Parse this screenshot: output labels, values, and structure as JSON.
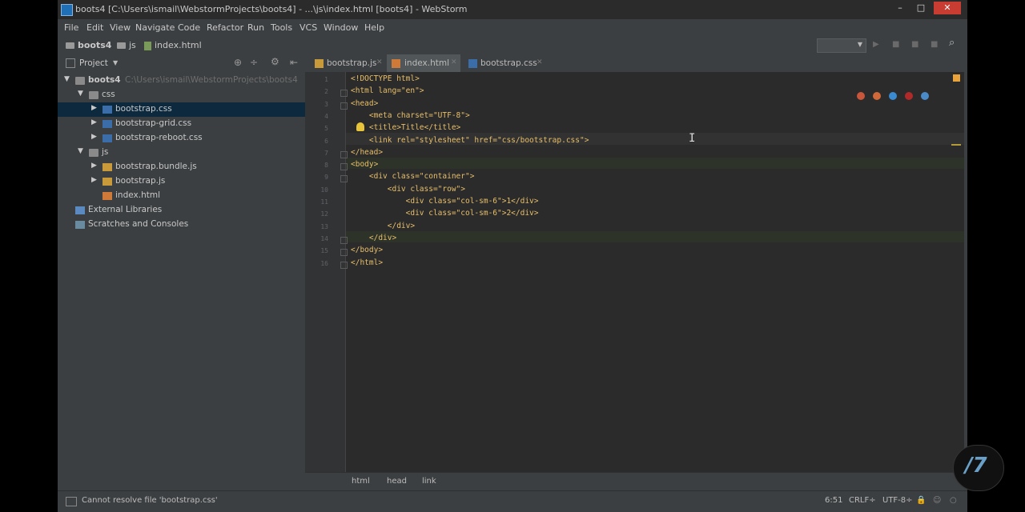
{
  "window": {
    "title": "boots4 [C:\\Users\\ismail\\WebstormProjects\\boots4] - ...\\js\\index.html [boots4] - WebStorm",
    "minimize": "–",
    "maximize": "□",
    "close": "✕"
  },
  "menu": [
    "File",
    "Edit",
    "View",
    "Navigate",
    "Code",
    "Refactor",
    "Run",
    "Tools",
    "VCS",
    "Window",
    "Help"
  ],
  "navbar": {
    "crumbs": [
      {
        "label": "boots4",
        "icon": "folder-icon"
      },
      {
        "label": "js",
        "icon": "folder-icon"
      },
      {
        "label": "index.html",
        "icon": "html-file-icon"
      }
    ]
  },
  "project_panel": {
    "title": "Project",
    "tree": [
      {
        "label": "boots4",
        "path": "C:\\Users\\ismail\\WebstormProjects\\boots4",
        "icon": "folder",
        "arrow": "▼",
        "depth": 0
      },
      {
        "label": "css",
        "path": "",
        "icon": "folder",
        "arrow": "▼",
        "depth": 1
      },
      {
        "label": "bootstrap.css",
        "path": "",
        "icon": "css",
        "arrow": "▶",
        "depth": 2,
        "selected": true
      },
      {
        "label": "bootstrap-grid.css",
        "path": "",
        "icon": "css",
        "arrow": "▶",
        "depth": 2
      },
      {
        "label": "bootstrap-reboot.css",
        "path": "",
        "icon": "css",
        "arrow": "▶",
        "depth": 2
      },
      {
        "label": "js",
        "path": "",
        "icon": "folder",
        "arrow": "▼",
        "depth": 1
      },
      {
        "label": "bootstrap.bundle.js",
        "path": "",
        "icon": "js",
        "arrow": "▶",
        "depth": 2
      },
      {
        "label": "bootstrap.js",
        "path": "",
        "icon": "js",
        "arrow": "▶",
        "depth": 2
      },
      {
        "label": "index.html",
        "path": "",
        "icon": "html",
        "arrow": "",
        "depth": 2
      },
      {
        "label": "External Libraries",
        "path": "",
        "icon": "lib",
        "arrow": "",
        "depth": 0
      },
      {
        "label": "Scratches and Consoles",
        "path": "",
        "icon": "scratch",
        "arrow": "",
        "depth": 0
      }
    ]
  },
  "tabs": [
    {
      "label": "bootstrap.js",
      "icon": "js",
      "active": false
    },
    {
      "label": "index.html",
      "icon": "html",
      "active": true
    },
    {
      "label": "bootstrap.css",
      "icon": "css",
      "active": false
    }
  ],
  "editor": {
    "lines": [
      "<!DOCTYPE html>",
      "<html lang=\"en\">",
      "<head>",
      "    <meta charset=\"UTF-8\">",
      "    <title>Title</title>",
      "    <link rel=\"stylesheet\" href=\"css/bootstrap.css\">",
      "</head>",
      "<body>",
      "    <div class=\"container\">",
      "        <div class=\"row\">",
      "            <div class=\"col-sm-6\">1</div>",
      "            <div class=\"col-sm-6\">2</div>",
      "        </div>",
      "    </div>",
      "</body>",
      "</html>"
    ]
  },
  "breadcrumbs": [
    "html",
    "head",
    "link"
  ],
  "status": {
    "message": "Cannot resolve file 'bootstrap.css'",
    "position": "6:51",
    "line_ending": "CRLF÷",
    "encoding": "UTF-8÷"
  }
}
